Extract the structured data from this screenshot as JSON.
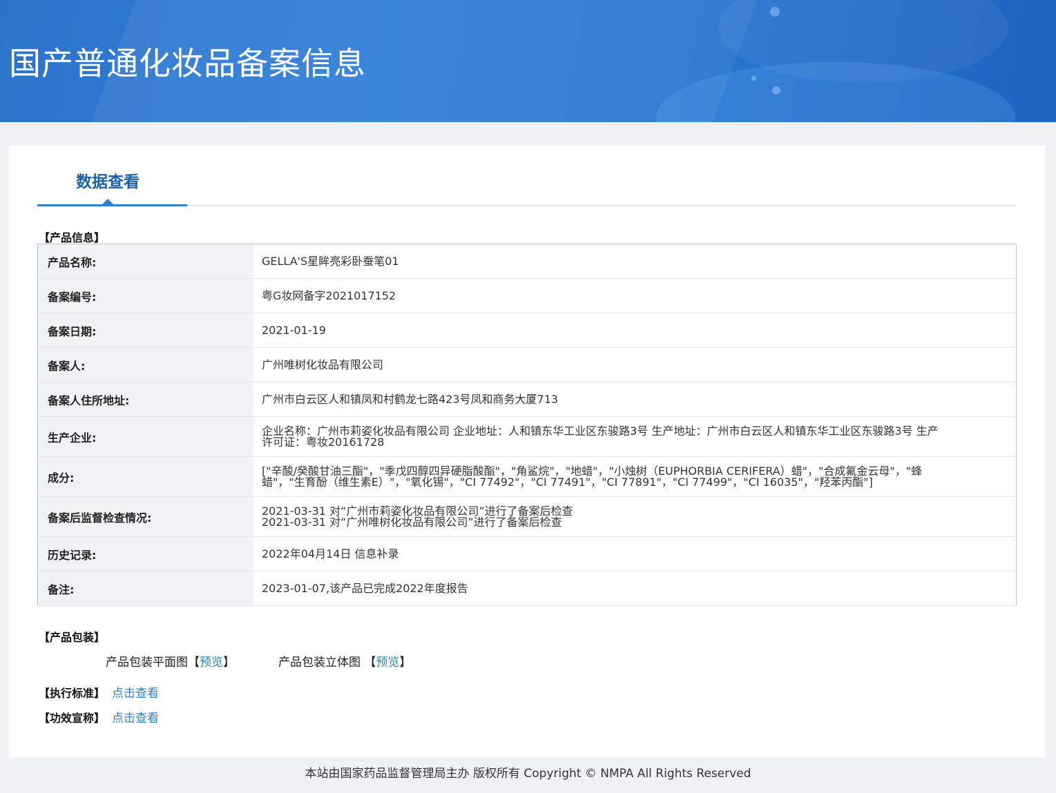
{
  "header": {
    "title": "国产普通化妆品备案信息"
  },
  "tab": {
    "label": "数据查看"
  },
  "product_info": {
    "section_title": "【产品信息】",
    "rows": [
      {
        "label": "产品名称:",
        "lines": [
          "GELLA'S星眸亮彩卧蚕笔01"
        ]
      },
      {
        "label": "备案编号:",
        "lines": [
          "粤G妆网备字2021017152"
        ]
      },
      {
        "label": "备案日期:",
        "lines": [
          "2021-01-19"
        ]
      },
      {
        "label": "备案人:",
        "lines": [
          "广州唯树化妆品有限公司"
        ]
      },
      {
        "label": "备案人住所地址:",
        "lines": [
          "广州市白云区人和镇凤和村鹤龙七路423号凤和商务大厦713"
        ]
      },
      {
        "label": "生产企业:",
        "lines": [
          "企业名称：广州市莉姿化妆品有限公司 企业地址：人和镇东华工业区东骏路3号 生产地址：广州市白云区人和镇东华工业区东骏路3号 生产",
          "许可证：粤妆20161728"
        ]
      },
      {
        "label": "成分:",
        "lines": [
          "[\"辛酸/癸酸甘油三酯\"，\"季戊四醇四异硬脂酸酯\"，\"角鲨烷\"，\"地蜡\"，\"小烛树（EUPHORBIA CERIFERA）蜡\"，\"合成氟金云母\"，\"蜂",
          "蜡\"，\"生育酚（维生素E）\"，\"氧化锡\"，\"CI 77492\"，\"CI 77491\"，\"CI 77891\"，\"CI 77499\"，\"CI 16035\"，\"羟苯丙酯\"]"
        ]
      },
      {
        "label": "备案后监督检查情况:",
        "lines": [
          "2021-03-31 对“广州市莉姿化妆品有限公司”进行了备案后检查",
          "2021-03-31 对“广州唯树化妆品有限公司”进行了备案后检查"
        ]
      },
      {
        "label": "历史记录:",
        "lines": [
          "2022年04月14日 信息补录"
        ]
      },
      {
        "label": "备注:",
        "lines": [
          "2023-01-07,该产品已完成2022年度报告"
        ]
      }
    ]
  },
  "packaging": {
    "section_title": "【产品包装】",
    "flat_label": "产品包装平面图",
    "stereo_label": "产品包装立体图",
    "bracket_open": "【",
    "bracket_close": "】",
    "preview_link": "预览"
  },
  "standard": {
    "label": "【执行标准】",
    "link": "点击查看"
  },
  "efficacy": {
    "label": "【功效宣称】",
    "link": "点击查看"
  },
  "footer": {
    "text": "本站由国家药品监督管理局主办 版权所有 Copyright © NMPA All Rights Reserved"
  }
}
